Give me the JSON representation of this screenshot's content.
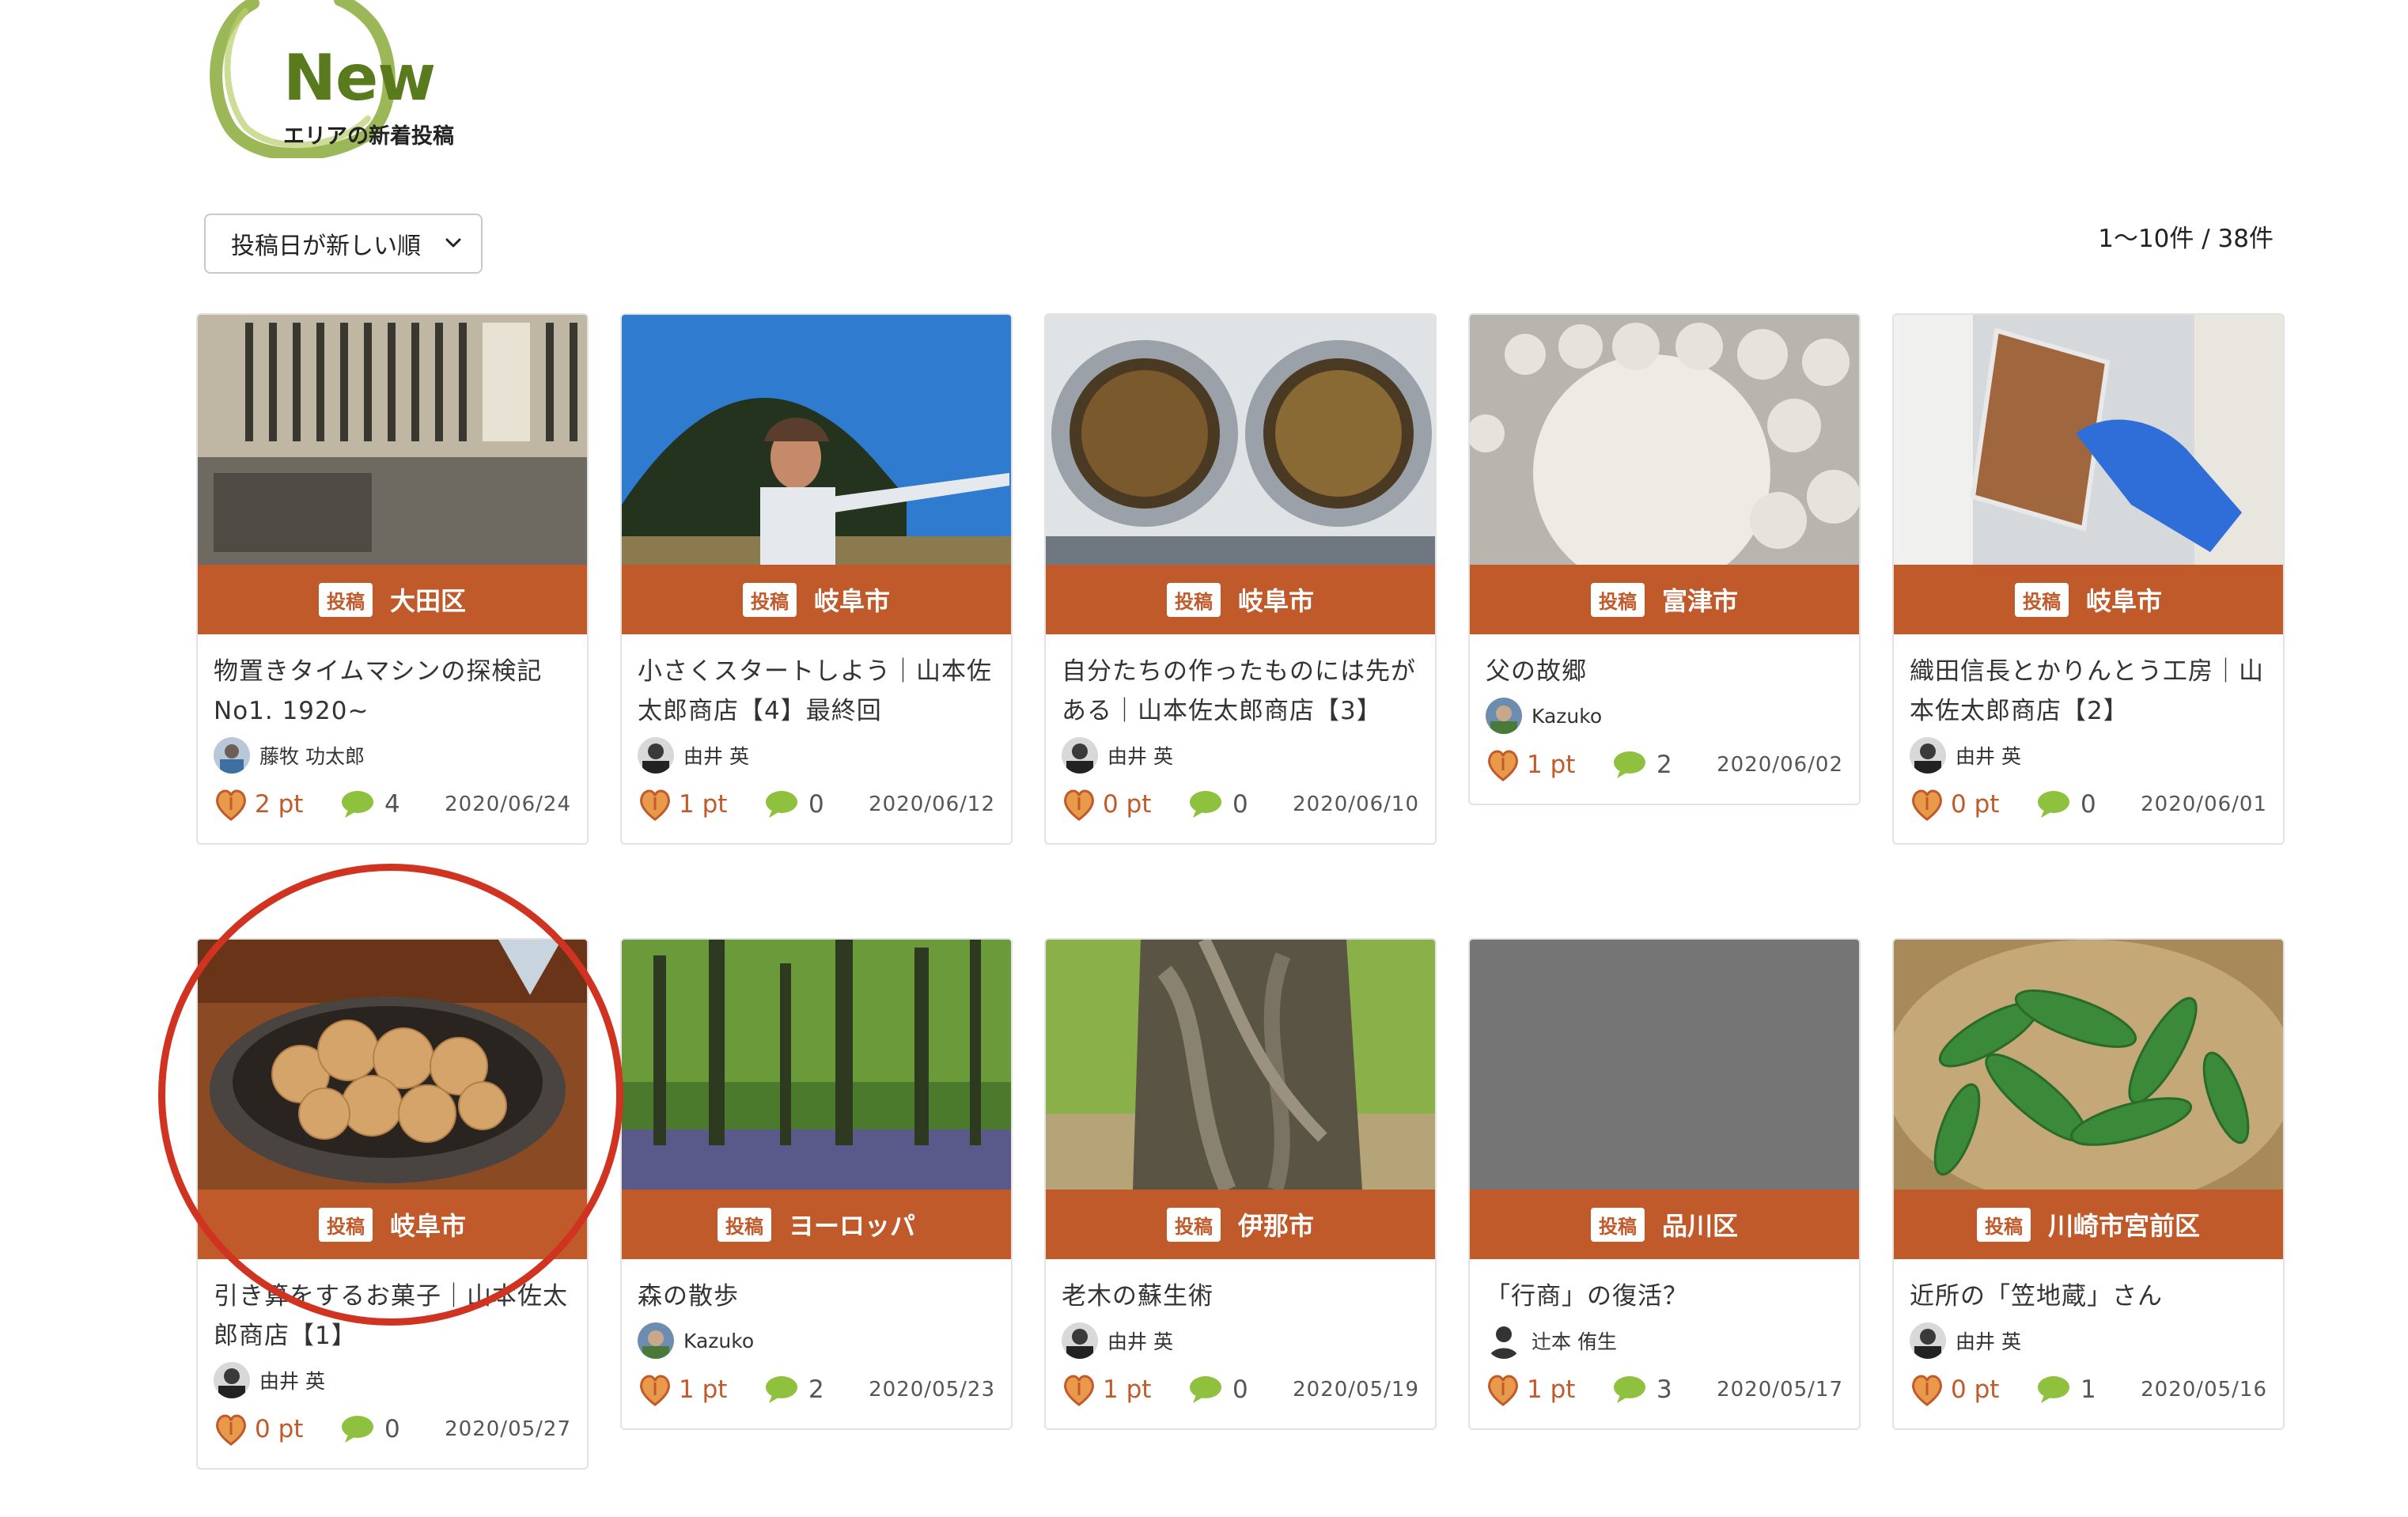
{
  "header": {
    "logo_title": "New",
    "logo_subtitle": "エリアの新着投稿"
  },
  "controls": {
    "sort_selected": "投稿日が新しい順",
    "result_count": "1〜10件 / 38件"
  },
  "colors": {
    "accent": "#c05a2b",
    "logo_green": "#8aaa3a",
    "highlight": "#d03320"
  },
  "cards": [
    {
      "badge": "投稿",
      "area": "大田区",
      "title": "物置きタイムマシンの探検記No1. 1920~",
      "author": "藤牧 功太郎",
      "points": "2 pt",
      "comments": "4",
      "date": "2020/06/24",
      "image": "newspaper-photo"
    },
    {
      "badge": "投稿",
      "area": "岐阜市",
      "title": "小さくスタートしよう｜山本佐太郎商店【4】最終回",
      "author": "由井 英",
      "points": "1 pt",
      "comments": "0",
      "date": "2020/06/12",
      "image": "man-pointing-photo"
    },
    {
      "badge": "投稿",
      "area": "岐阜市",
      "title": "自分たちの作ったものには先がある｜山本佐太郎商店【3】",
      "author": "由井 英",
      "points": "0 pt",
      "comments": "0",
      "date": "2020/06/10",
      "image": "frying-drums-photo"
    },
    {
      "badge": "投稿",
      "area": "富津市",
      "title": "父の故郷",
      "author": "Kazuko",
      "points": "1 pt",
      "comments": "2",
      "date": "2020/06/02",
      "image": "dough-balls-photo"
    },
    {
      "badge": "投稿",
      "area": "岐阜市",
      "title": "織田信長とかりんとう工房｜山本佐太郎商店【2】",
      "author": "由井 英",
      "points": "0 pt",
      "comments": "0",
      "date": "2020/06/01",
      "image": "karinto-bag-photo"
    },
    {
      "badge": "投稿",
      "area": "岐阜市",
      "title": "引き算をするお菓子｜山本佐太郎商店【1】",
      "author": "由井 英",
      "points": "0 pt",
      "comments": "0",
      "date": "2020/05/27",
      "image": "crackers-bowl-photo"
    },
    {
      "badge": "投稿",
      "area": "ヨーロッパ",
      "title": "森の散歩",
      "author": "Kazuko",
      "points": "1 pt",
      "comments": "2",
      "date": "2020/05/23",
      "image": "forest-photo"
    },
    {
      "badge": "投稿",
      "area": "伊那市",
      "title": "老木の蘇生術",
      "author": "由井 英",
      "points": "1 pt",
      "comments": "0",
      "date": "2020/05/19",
      "image": "old-tree-photo"
    },
    {
      "badge": "投稿",
      "area": "品川区",
      "title": "「行商」の復活？",
      "author": "辻本 侑生",
      "points": "1 pt",
      "comments": "3",
      "date": "2020/05/17",
      "image": "gray-placeholder"
    },
    {
      "badge": "投稿",
      "area": "川崎市宮前区",
      "title": "近所の「笠地蔵」さん",
      "author": "由井 英",
      "points": "0 pt",
      "comments": "1",
      "date": "2020/05/16",
      "image": "snap-peas-photo"
    }
  ]
}
